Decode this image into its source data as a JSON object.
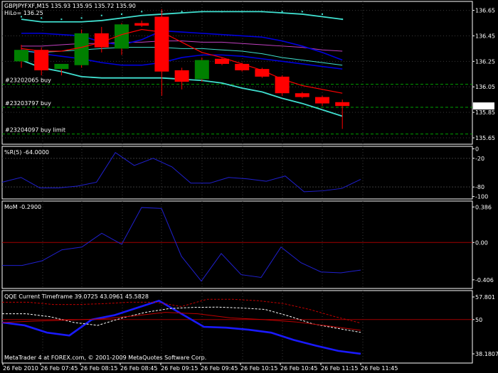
{
  "colors": {
    "bg": "#000000",
    "frame": "#ffffff",
    "grid": "#3a3a3a",
    "bull": "#008000",
    "bear": "#ff0000",
    "wick": "#ff0000",
    "cyan": "#40e0d0",
    "blue": "#0000dd",
    "magenta": "#c040c0",
    "orderLine": "#00a000",
    "zeroLine": "#a00000",
    "qqeWhite": "#ffffff",
    "qqeRed": "#c00000",
    "bidBox": "#ffffff"
  },
  "chart_data": [
    {
      "type": "candlestick",
      "title": "GBPJPYFXF,M15  135.93 135.95 135.72 135.90",
      "subtitle": "HiLo= 136.25",
      "ylim": [
        135.6,
        136.72
      ],
      "ticks": [
        "136.65",
        "136.45",
        "136.25",
        "136.05",
        "135.85",
        "135.65"
      ],
      "tick_values": [
        136.65,
        136.45,
        136.25,
        136.05,
        135.85,
        135.65
      ],
      "price_label": "135.90",
      "price_value": 135.9,
      "candles": [
        {
          "o": 136.25,
          "h": 136.38,
          "l": 136.2,
          "c": 136.34
        },
        {
          "o": 136.34,
          "h": 136.36,
          "l": 136.14,
          "c": 136.18
        },
        {
          "o": 136.19,
          "h": 136.22,
          "l": 136.14,
          "c": 136.23
        },
        {
          "o": 136.22,
          "h": 136.5,
          "l": 136.2,
          "c": 136.47
        },
        {
          "o": 136.47,
          "h": 136.52,
          "l": 136.32,
          "c": 136.36
        },
        {
          "o": 136.35,
          "h": 136.55,
          "l": 136.3,
          "c": 136.54
        },
        {
          "o": 136.55,
          "h": 136.57,
          "l": 136.52,
          "c": 136.53
        },
        {
          "o": 136.6,
          "h": 136.66,
          "l": 135.98,
          "c": 136.17
        },
        {
          "o": 136.18,
          "h": 136.2,
          "l": 136.03,
          "c": 136.09
        },
        {
          "o": 136.11,
          "h": 136.28,
          "l": 136.09,
          "c": 136.26
        },
        {
          "o": 136.27,
          "h": 136.28,
          "l": 136.22,
          "c": 136.23
        },
        {
          "o": 136.23,
          "h": 136.24,
          "l": 136.17,
          "c": 136.18
        },
        {
          "o": 136.19,
          "h": 136.2,
          "l": 136.12,
          "c": 136.13
        },
        {
          "o": 136.13,
          "h": 136.14,
          "l": 135.98,
          "c": 136.0
        },
        {
          "o": 136.0,
          "h": 136.01,
          "l": 135.96,
          "c": 135.97
        },
        {
          "o": 135.97,
          "h": 135.98,
          "l": 135.9,
          "c": 135.92
        },
        {
          "o": 135.93,
          "h": 135.95,
          "l": 135.72,
          "c": 135.9
        }
      ],
      "upper_dots": [
        136.6,
        136.59,
        136.58,
        136.59,
        136.61,
        136.62,
        136.64,
        136.64,
        136.64,
        136.64,
        136.64,
        136.64,
        136.64,
        136.64,
        136.64,
        136.62,
        136.58
      ],
      "cyan_upper": [
        136.58,
        136.56,
        136.56,
        136.56,
        136.57,
        136.59,
        136.61,
        136.62,
        136.63,
        136.64,
        136.64,
        136.64,
        136.64,
        136.63,
        136.62,
        136.6,
        136.58
      ],
      "cyan_lower": [
        136.26,
        136.2,
        136.17,
        136.13,
        136.12,
        136.12,
        136.12,
        136.12,
        136.11,
        136.1,
        136.08,
        136.04,
        136.01,
        135.96,
        135.92,
        135.87,
        135.82
      ],
      "cyan_mid": [
        136.33,
        136.32,
        136.33,
        136.34,
        136.35,
        136.36,
        136.36,
        136.36,
        136.35,
        136.35,
        136.34,
        136.33,
        136.31,
        136.28,
        136.26,
        136.24,
        136.22
      ],
      "blue_upper": [
        136.47,
        136.47,
        136.46,
        136.45,
        136.4,
        136.38,
        136.42,
        136.49,
        136.48,
        136.47,
        136.46,
        136.45,
        136.44,
        136.41,
        136.37,
        136.32,
        136.26
      ],
      "blue_lower": [
        136.34,
        136.31,
        136.29,
        136.27,
        136.24,
        136.22,
        136.22,
        136.24,
        136.28,
        136.3,
        136.3,
        136.29,
        136.27,
        136.25,
        136.23,
        136.21,
        136.19
      ],
      "magenta": [
        136.37,
        136.37,
        136.38,
        136.39,
        136.39,
        136.4,
        136.4,
        136.41,
        136.41,
        136.4,
        136.4,
        136.39,
        136.38,
        136.37,
        136.36,
        136.34,
        136.33
      ],
      "red_ma": [
        136.35,
        136.33,
        136.33,
        136.36,
        136.4,
        136.46,
        136.5,
        136.48,
        136.4,
        136.32,
        136.28,
        136.23,
        136.18,
        136.11,
        136.06,
        136.03,
        136.0
      ],
      "orders": [
        {
          "label": "#23202065 buy",
          "value": 136.07
        },
        {
          "label": "#23203797 buy",
          "value": 135.89
        },
        {
          "label": "#23204097 buy limit",
          "value": 135.68
        }
      ]
    },
    {
      "type": "line",
      "title": "%R(5) -64.0000",
      "ylim": [
        -105,
        5
      ],
      "ticks": [
        "0",
        "-20",
        "-80",
        "-100"
      ],
      "tick_values": [
        0,
        -20,
        -80,
        -100
      ],
      "levels": [
        -20,
        -80
      ],
      "series": [
        {
          "values": [
            -70,
            -60,
            -82,
            -82,
            -78,
            -70,
            -8,
            -35,
            -20,
            -38,
            -72,
            -72,
            -60,
            -63,
            -68,
            -57,
            -90,
            -88,
            -83,
            -64
          ]
        }
      ]
    },
    {
      "type": "line",
      "title": "MoM  -0.2900",
      "ylim": [
        -0.5,
        0.45
      ],
      "ticks": [
        "0.386",
        "0.00",
        "-0.406"
      ],
      "tick_values": [
        0.386,
        0.0,
        -0.406
      ],
      "levels": [
        0.0
      ],
      "series": [
        {
          "values": [
            -0.25,
            -0.25,
            -0.2,
            -0.08,
            -0.05,
            0.1,
            -0.02,
            0.38,
            0.37,
            -0.15,
            -0.42,
            -0.12,
            -0.35,
            -0.38,
            -0.05,
            -0.22,
            -0.32,
            -0.33,
            -0.3
          ]
        }
      ]
    },
    {
      "type": "line",
      "title": "QQE Current Timeframe 39.0725 43.0961 45.5828",
      "ylim": [
        35,
        60
      ],
      "ticks": [
        "57.801",
        "50",
        "38.1807"
      ],
      "tick_values": [
        57.801,
        50,
        38.1807
      ],
      "levels": [
        50
      ],
      "series": [
        {
          "values": [
            49,
            48,
            45.5,
            44.5,
            50,
            51.5,
            54,
            56.5,
            52,
            47.5,
            47.2,
            46.5,
            45.5,
            43,
            41,
            39.2,
            38.2
          ]
        },
        {
          "values": [
            52,
            52,
            51,
            49,
            48,
            50.5,
            52.5,
            53.8,
            54.2,
            54.3,
            54,
            53.5,
            51.2,
            48.5,
            47,
            45.6
          ]
        },
        {
          "values": [
            56,
            56,
            55.2,
            55.2,
            55.5,
            56,
            56,
            54.5,
            57,
            57,
            56.5,
            55.5,
            53.5,
            51,
            48.8
          ]
        },
        {
          "values": [
            49,
            49.5,
            49.8,
            50.2,
            51.2,
            52.5,
            52,
            50.6,
            50,
            49.2,
            47.8,
            46.3
          ]
        }
      ]
    }
  ],
  "time_axis": [
    "26 Feb 2010",
    "26 Feb 07:45",
    "26 Feb 08:15",
    "26 Feb 08:45",
    "26 Feb 09:15",
    "26 Feb 09:45",
    "26 Feb 10:15",
    "26 Feb 10:45",
    "26 Feb 11:15",
    "26 Feb 11:45"
  ],
  "footer": "MetaTrader 4 at FOREX.com, © 2001-2009 MetaQuotes Software Corp."
}
